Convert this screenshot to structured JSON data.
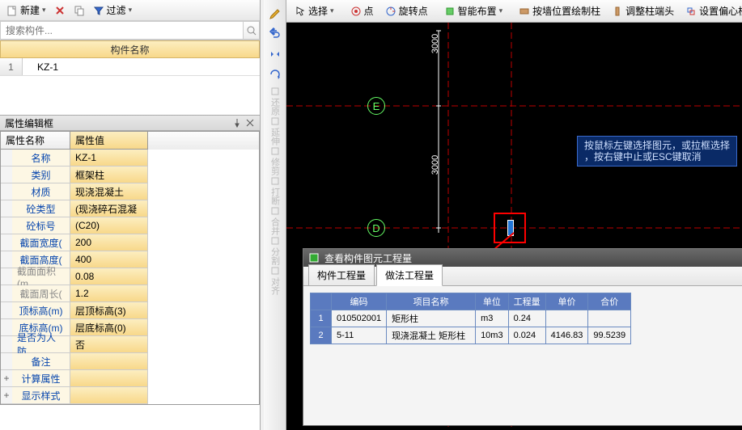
{
  "toolbar": {
    "new": "新建",
    "filter": "过滤"
  },
  "search": {
    "placeholder": "搜索构件..."
  },
  "complist": {
    "header": "构件名称",
    "rows": [
      {
        "n": "1",
        "name": "KZ-1"
      }
    ]
  },
  "propPanel": {
    "title": "属性编辑框",
    "col1": "属性名称",
    "col2": "属性值"
  },
  "props": [
    {
      "k": "名称",
      "v": "KZ-1"
    },
    {
      "k": "类别",
      "v": "框架柱"
    },
    {
      "k": "材质",
      "v": "现浇混凝土"
    },
    {
      "k": "砼类型",
      "v": "(现浇碎石混凝"
    },
    {
      "k": "砼标号",
      "v": "(C20)"
    },
    {
      "k": "截面宽度(",
      "v": "200"
    },
    {
      "k": "截面高度(",
      "v": "400"
    },
    {
      "k": "截面面积(m",
      "v": "0.08",
      "g": true
    },
    {
      "k": "截面周长(",
      "v": "1.2",
      "g": true
    },
    {
      "k": "顶标高(m)",
      "v": "层顶标高(3)"
    },
    {
      "k": "底标高(m)",
      "v": "层底标高(0)"
    },
    {
      "k": "是否为人防",
      "v": "否"
    },
    {
      "k": "备注",
      "v": ""
    },
    {
      "k": "计算属性",
      "v": "",
      "exp": true
    },
    {
      "k": "显示样式",
      "v": "",
      "exp": true
    }
  ],
  "vtools": [
    "还原",
    "延伸",
    "修剪",
    "打断",
    "合并",
    "分割",
    "对齐"
  ],
  "ribbon": {
    "select": "选择",
    "point": "点",
    "rotpoint": "旋转点",
    "smart": "智能布置",
    "drawbypos": "按墙位置绘制柱",
    "adjhead": "调整柱端头",
    "offset": "设置偏心柱"
  },
  "canvas": {
    "dim1": "3000",
    "dim2": "3000",
    "labelE": "E",
    "labelD": "D"
  },
  "tooltip": {
    "l1": "按鼠标左键选择图元，或拉框选择",
    "l2": "，按右键中止或ESC键取消"
  },
  "qty": {
    "title": "查看构件图元工程量",
    "tab1": "构件工程量",
    "tab2": "做法工程量",
    "headers": [
      "编码",
      "项目名称",
      "单位",
      "工程量",
      "单价",
      "合价"
    ],
    "rows": [
      {
        "n": "1",
        "code": "010502001",
        "name": "矩形柱",
        "unit": "m3",
        "qty": "0.24",
        "price": "",
        "total": ""
      },
      {
        "n": "2",
        "code": "5-11",
        "name": "现浇混凝土 矩形柱",
        "unit": "10m3",
        "qty": "0.024",
        "price": "4146.83",
        "total": "99.5239"
      }
    ]
  }
}
